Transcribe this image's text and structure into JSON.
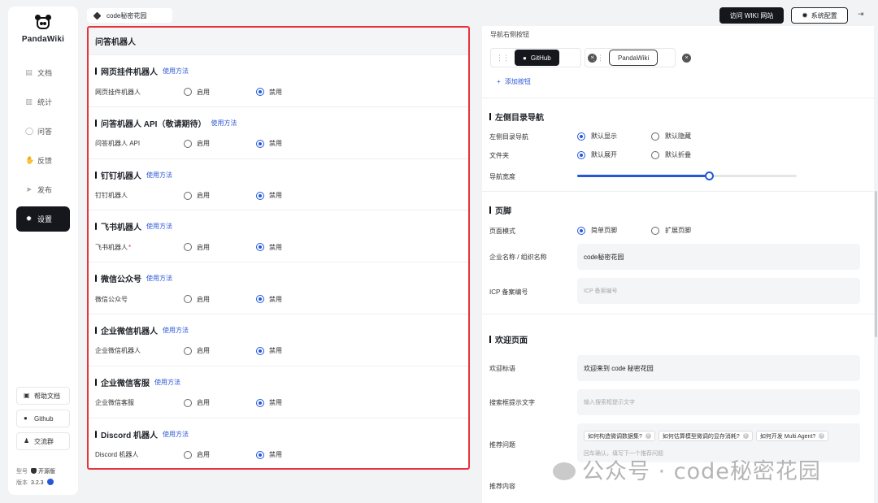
{
  "app": {
    "name": "PandaWiki",
    "breadcrumb": "code秘密花园"
  },
  "sidebar": {
    "items": [
      {
        "label": "文档",
        "icon": "document-icon"
      },
      {
        "label": "统计",
        "icon": "bar-chart-icon"
      },
      {
        "label": "问答",
        "icon": "chat-icon"
      },
      {
        "label": "反馈",
        "icon": "hand-icon"
      },
      {
        "label": "发布",
        "icon": "send-icon"
      },
      {
        "label": "设置",
        "icon": "gear-icon",
        "active": true
      }
    ],
    "help_label": "帮助文档",
    "github_label": "Github",
    "group_label": "交流群",
    "model_label": "型号",
    "model_value": "开源版",
    "version_label": "版本",
    "version_value": "3.2.3"
  },
  "topbar": {
    "visit_wiki": "访问 WIKI 网站",
    "system_config": "系统配置"
  },
  "qa_panel": {
    "title": "问答机器人",
    "sections": [
      {
        "title": "网页挂件机器人",
        "link": "使用方法",
        "label": "网页挂件机器人",
        "required": false,
        "enable": "启用",
        "disable": "禁用",
        "selected": "禁用"
      },
      {
        "title": "问答机器人 API（敬请期待）",
        "link": "使用方法",
        "label": "问答机器人 API",
        "required": false,
        "enable": "启用",
        "disable": "禁用",
        "selected": "禁用"
      },
      {
        "title": "钉钉机器人",
        "link": "使用方法",
        "label": "钉钉机器人",
        "required": false,
        "enable": "启用",
        "disable": "禁用",
        "selected": "禁用"
      },
      {
        "title": "飞书机器人",
        "link": "使用方法",
        "label": "飞书机器人",
        "required": true,
        "enable": "启用",
        "disable": "禁用",
        "selected": "禁用"
      },
      {
        "title": "微信公众号",
        "link": "使用方法",
        "label": "微信公众号",
        "required": false,
        "enable": "启用",
        "disable": "禁用",
        "selected": "禁用"
      },
      {
        "title": "企业微信机器人",
        "link": "使用方法",
        "label": "企业微信机器人",
        "required": false,
        "enable": "启用",
        "disable": "禁用",
        "selected": "禁用"
      },
      {
        "title": "企业微信客服",
        "link": "使用方法",
        "label": "企业微信客服",
        "required": false,
        "enable": "启用",
        "disable": "禁用",
        "selected": "禁用"
      },
      {
        "title": "Discord 机器人",
        "link": "使用方法",
        "label": "Discord 机器人",
        "required": false,
        "enable": "启用",
        "disable": "禁用",
        "selected": "禁用"
      }
    ]
  },
  "right_panel": {
    "nav_buttons_caption": "导航右侧按钮",
    "nav_buttons": [
      "GitHub",
      "PandaWiki"
    ],
    "add_button": "添加按钮",
    "left_nav": {
      "title": "左侧目录导航",
      "row1_label": "左侧目录导航",
      "row1_opt1": "默认显示",
      "row1_opt2": "默认隐藏",
      "row2_label": "文件夹",
      "row2_opt1": "默认展开",
      "row2_opt2": "默认折叠",
      "width_label": "导航宽度",
      "width_fraction": 0.6
    },
    "footer": {
      "title": "页脚",
      "mode_label": "页面模式",
      "mode_opt1": "简单页脚",
      "mode_opt2": "扩展页脚",
      "org_label": "企业名称 / 组织名称",
      "org_value": "code秘密花园",
      "icp_label": "ICP 备案编号",
      "icp_placeholder": "ICP 备案编号"
    },
    "welcome": {
      "title": "欢迎页面",
      "slogan_label": "欢迎标语",
      "slogan_value": "欢迎来到 code 秘密花园",
      "search_label": "搜索框提示文字",
      "search_placeholder": "输入搜索框提示文字",
      "questions_label": "推荐问题",
      "questions": [
        "如何构造微调数据集?",
        "如何估算模型微调的显存消耗?",
        "如何开发 Multi Agent?"
      ],
      "questions_placeholder": "回车确认，填写下一个推荐问题",
      "content_label": "推荐内容"
    }
  },
  "watermark": "公众号 · code秘密花园",
  "colors": {
    "accent": "#2458d9",
    "highlight_border": "#e8323c",
    "dark": "#15171c"
  }
}
